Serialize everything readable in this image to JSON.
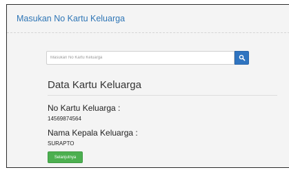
{
  "panel": {
    "title": "Masukan No Kartu Keluarga"
  },
  "search": {
    "placeholder": "Masukan No Kartu Keluarga",
    "value": "",
    "button_icon": "search-icon"
  },
  "data_section": {
    "title": "Data Kartu Keluarga",
    "no_kk_label": "No Kartu Keluarga :",
    "no_kk_value": "14569874564",
    "kepala_label": "Nama Kepala Keluarga :",
    "kepala_value": "SURAPTO"
  },
  "actions": {
    "next_label": "Selanjutnya"
  },
  "colors": {
    "title_link": "#2f76b6",
    "search_button": "#2f74c0",
    "next_button": "#4caf50"
  }
}
